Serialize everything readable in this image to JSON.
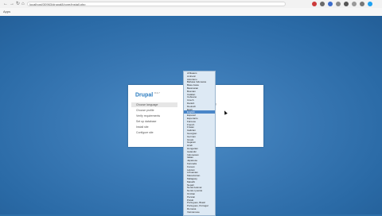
{
  "browser": {
    "url": "localhost/30963/drupal8/core/install.php",
    "bookmarks_label": "Apps"
  },
  "installer": {
    "logo": "Drupal",
    "version": "8.3.7",
    "steps": [
      {
        "label": "Choose language",
        "active": true
      },
      {
        "label": "Choose profile",
        "active": false
      },
      {
        "label": "Verify requirements",
        "active": false
      },
      {
        "label": "Set up database",
        "active": false
      },
      {
        "label": "Install site",
        "active": false
      },
      {
        "label": "Configure site",
        "active": false
      }
    ],
    "partial_text": "e"
  },
  "language_dropdown": {
    "selected": "English",
    "options": [
      "Afrikaans",
      "Amharic",
      "Asturianu",
      "Bahasa Indonesia",
      "Basa Jawa",
      "Beiarusian",
      "Bosnian",
      "Catalan",
      "Cebuano",
      "Czech",
      "Danish",
      "Deutsch",
      "Eesti",
      "English",
      "Espanol",
      "Esperanto",
      "Faroese",
      "French",
      "Frisian",
      "Galician",
      "Georgian",
      "German",
      "Greek",
      "Gujarati",
      "Hindi",
      "Hungarian",
      "Icelandic",
      "Indonesian",
      "Italian",
      "Japanese",
      "Kannada",
      "Korean",
      "Latvian",
      "Lithuanian",
      "Macedonian",
      "Malagasy",
      "Marathi",
      "Nepali",
      "Norsk bokmal",
      "Norsk nynorsk",
      "Occitan",
      "Persian",
      "Polski",
      "Portugues, Brasil",
      "Portugues, Portugal",
      "Romana",
      "Vietnamese"
    ]
  }
}
